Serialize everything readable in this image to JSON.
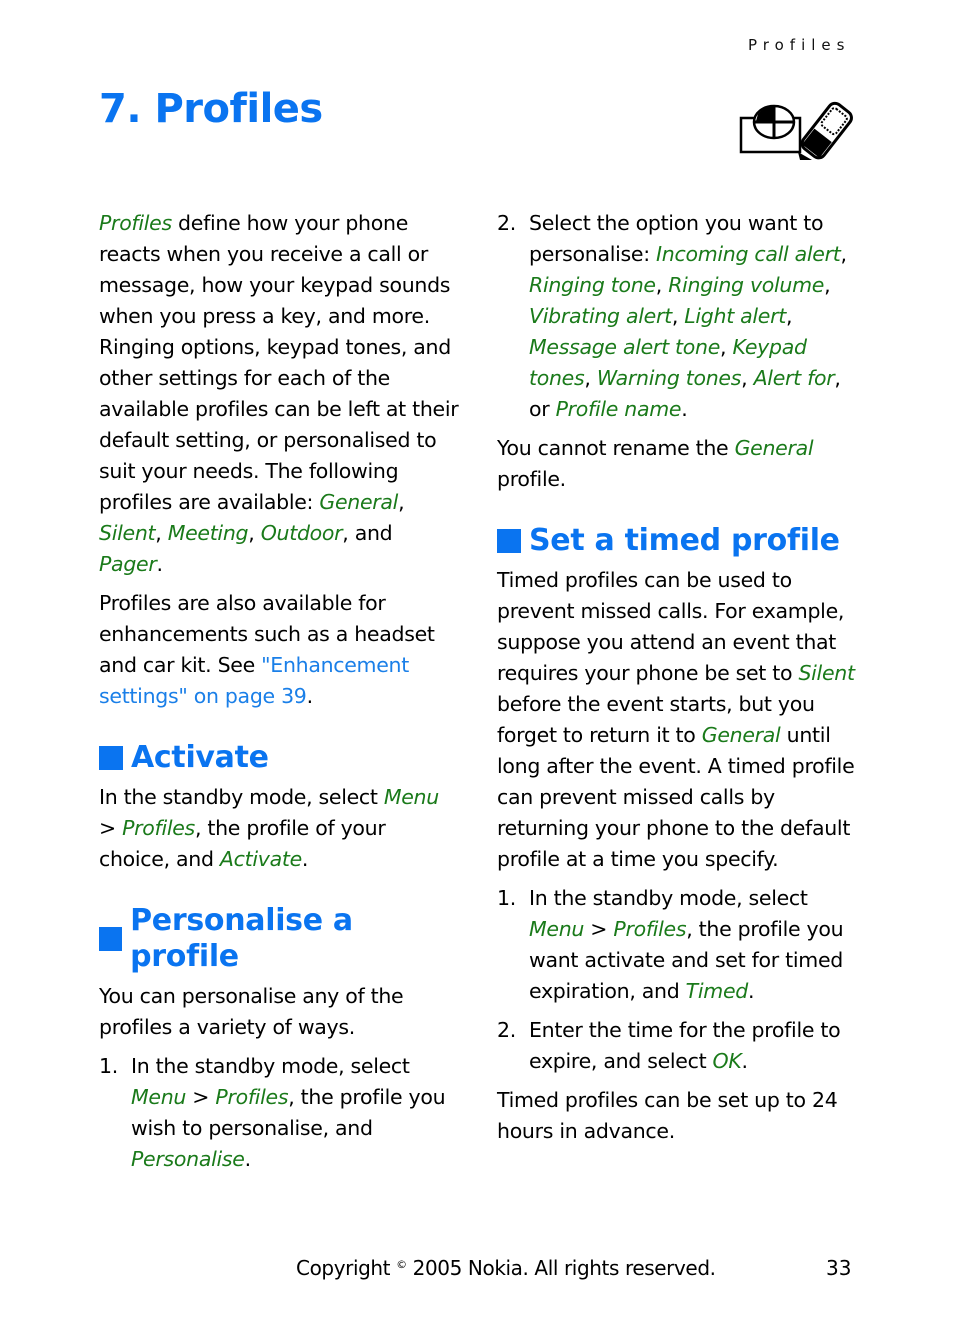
{
  "header": {
    "running_title": "Profiles",
    "chapter_title": "7. Profiles",
    "chapter_icon": "profiles-phone-icon"
  },
  "left_column": {
    "intro": [
      {
        "t": "em",
        "v": "Profiles"
      },
      {
        "t": "n",
        "v": " define how your phone reacts when you receive a call or message, how your keypad sounds when you press a key, and more. Ringing options, keypad tones, and other settings for each of the available profiles can be left at their default setting, or personalised to suit your needs. The following profiles are available: "
      },
      {
        "t": "em",
        "v": "General"
      },
      {
        "t": "n",
        "v": ", "
      },
      {
        "t": "em",
        "v": "Silent"
      },
      {
        "t": "n",
        "v": ", "
      },
      {
        "t": "em",
        "v": "Meeting"
      },
      {
        "t": "n",
        "v": ", "
      },
      {
        "t": "em",
        "v": "Outdoor"
      },
      {
        "t": "n",
        "v": ", and "
      },
      {
        "t": "em",
        "v": "Pager"
      },
      {
        "t": "n",
        "v": "."
      }
    ],
    "enhancements": [
      {
        "t": "n",
        "v": "Profiles are also available for enhancements such as a headset and car kit. See "
      },
      {
        "t": "link",
        "v": "\"Enhancement settings\" on page 39"
      },
      {
        "t": "n",
        "v": "."
      }
    ],
    "activate": {
      "heading": "Activate",
      "body": [
        {
          "t": "n",
          "v": "In the standby mode, select "
        },
        {
          "t": "em",
          "v": "Menu"
        },
        {
          "t": "n",
          "v": " > "
        },
        {
          "t": "em",
          "v": "Profiles"
        },
        {
          "t": "n",
          "v": ", the profile of your choice, and "
        },
        {
          "t": "em",
          "v": "Activate"
        },
        {
          "t": "n",
          "v": "."
        }
      ]
    },
    "personalise": {
      "heading": "Personalise a profile",
      "body": [
        {
          "t": "n",
          "v": "You can personalise any of the profiles a variety of ways."
        }
      ],
      "step1": {
        "num": "1.",
        "runs": [
          {
            "t": "n",
            "v": "In the standby mode, select "
          },
          {
            "t": "em",
            "v": "Menu"
          },
          {
            "t": "n",
            "v": " > "
          },
          {
            "t": "em",
            "v": "Profiles"
          },
          {
            "t": "n",
            "v": ", the profile you wish to personalise, and "
          },
          {
            "t": "em",
            "v": "Personalise"
          },
          {
            "t": "n",
            "v": "."
          }
        ]
      }
    }
  },
  "right_column": {
    "step2": {
      "num": "2.",
      "runs": [
        {
          "t": "n",
          "v": "Select the option you want to personalise: "
        },
        {
          "t": "em",
          "v": "Incoming call alert"
        },
        {
          "t": "n",
          "v": ", "
        },
        {
          "t": "em",
          "v": "Ringing tone"
        },
        {
          "t": "n",
          "v": ", "
        },
        {
          "t": "em",
          "v": "Ringing volume"
        },
        {
          "t": "n",
          "v": ", "
        },
        {
          "t": "em",
          "v": "Vibrating alert"
        },
        {
          "t": "n",
          "v": ", "
        },
        {
          "t": "em",
          "v": "Light alert"
        },
        {
          "t": "n",
          "v": ", "
        },
        {
          "t": "em",
          "v": "Message alert tone"
        },
        {
          "t": "n",
          "v": ", "
        },
        {
          "t": "em",
          "v": "Keypad tones"
        },
        {
          "t": "n",
          "v": ", "
        },
        {
          "t": "em",
          "v": "Warning tones"
        },
        {
          "t": "n",
          "v": ", "
        },
        {
          "t": "em",
          "v": "Alert for"
        },
        {
          "t": "n",
          "v": ", or "
        },
        {
          "t": "em",
          "v": "Profile name"
        },
        {
          "t": "n",
          "v": "."
        }
      ]
    },
    "rename_note": [
      {
        "t": "n",
        "v": "You cannot rename the "
      },
      {
        "t": "em",
        "v": "General"
      },
      {
        "t": "n",
        "v": " profile."
      }
    ],
    "timed": {
      "heading": "Set a timed profile",
      "body": [
        {
          "t": "n",
          "v": "Timed profiles can be used to prevent missed calls. For example, suppose you attend an event that requires your phone be set to "
        },
        {
          "t": "em",
          "v": "Silent"
        },
        {
          "t": "n",
          "v": " before the event starts, but you forget to return it to "
        },
        {
          "t": "em",
          "v": "General"
        },
        {
          "t": "n",
          "v": " until long after the event. A timed profile can prevent missed calls by returning your phone to the default profile at a time you specify."
        }
      ],
      "steps": [
        {
          "num": "1.",
          "runs": [
            {
              "t": "n",
              "v": "In the standby mode, select "
            },
            {
              "t": "em",
              "v": "Menu"
            },
            {
              "t": "n",
              "v": " > "
            },
            {
              "t": "em",
              "v": "Profiles"
            },
            {
              "t": "n",
              "v": ", the profile you want activate and set for timed expiration, and "
            },
            {
              "t": "em",
              "v": "Timed"
            },
            {
              "t": "n",
              "v": "."
            }
          ]
        },
        {
          "num": "2.",
          "runs": [
            {
              "t": "n",
              "v": "Enter the time for the profile to expire, and select "
            },
            {
              "t": "em",
              "v": "OK"
            },
            {
              "t": "n",
              "v": "."
            }
          ]
        }
      ],
      "closing": [
        {
          "t": "n",
          "v": "Timed profiles can be set up to 24 hours in advance."
        }
      ]
    }
  },
  "footer": {
    "copyright_prefix": "Copyright ",
    "copyright_symbol": "©",
    "copyright_suffix": " 2005 Nokia. All rights reserved.",
    "page_number": "33"
  }
}
